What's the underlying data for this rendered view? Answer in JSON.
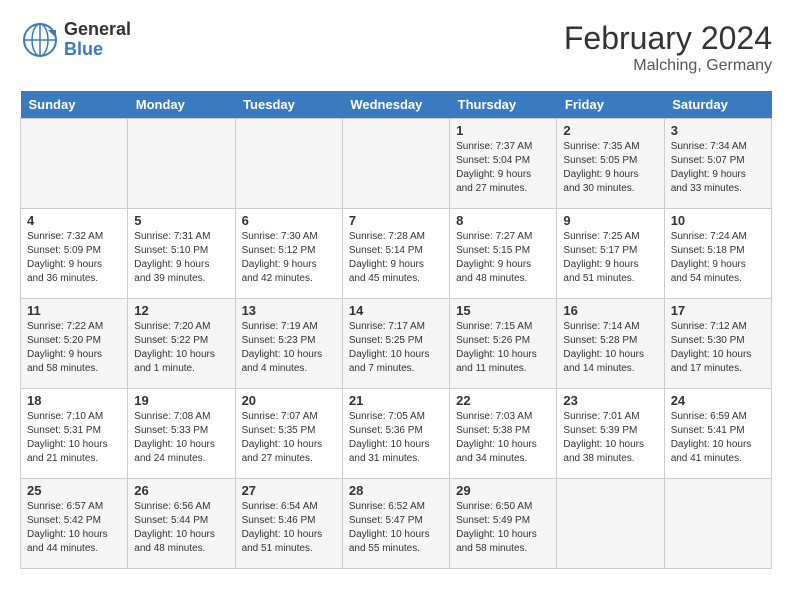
{
  "header": {
    "logo_general": "General",
    "logo_blue": "Blue",
    "month_year": "February 2024",
    "location": "Malching, Germany"
  },
  "days_of_week": [
    "Sunday",
    "Monday",
    "Tuesday",
    "Wednesday",
    "Thursday",
    "Friday",
    "Saturday"
  ],
  "weeks": [
    [
      {
        "num": "",
        "info": ""
      },
      {
        "num": "",
        "info": ""
      },
      {
        "num": "",
        "info": ""
      },
      {
        "num": "",
        "info": ""
      },
      {
        "num": "1",
        "info": "Sunrise: 7:37 AM\nSunset: 5:04 PM\nDaylight: 9 hours\nand 27 minutes."
      },
      {
        "num": "2",
        "info": "Sunrise: 7:35 AM\nSunset: 5:05 PM\nDaylight: 9 hours\nand 30 minutes."
      },
      {
        "num": "3",
        "info": "Sunrise: 7:34 AM\nSunset: 5:07 PM\nDaylight: 9 hours\nand 33 minutes."
      }
    ],
    [
      {
        "num": "4",
        "info": "Sunrise: 7:32 AM\nSunset: 5:09 PM\nDaylight: 9 hours\nand 36 minutes."
      },
      {
        "num": "5",
        "info": "Sunrise: 7:31 AM\nSunset: 5:10 PM\nDaylight: 9 hours\nand 39 minutes."
      },
      {
        "num": "6",
        "info": "Sunrise: 7:30 AM\nSunset: 5:12 PM\nDaylight: 9 hours\nand 42 minutes."
      },
      {
        "num": "7",
        "info": "Sunrise: 7:28 AM\nSunset: 5:14 PM\nDaylight: 9 hours\nand 45 minutes."
      },
      {
        "num": "8",
        "info": "Sunrise: 7:27 AM\nSunset: 5:15 PM\nDaylight: 9 hours\nand 48 minutes."
      },
      {
        "num": "9",
        "info": "Sunrise: 7:25 AM\nSunset: 5:17 PM\nDaylight: 9 hours\nand 51 minutes."
      },
      {
        "num": "10",
        "info": "Sunrise: 7:24 AM\nSunset: 5:18 PM\nDaylight: 9 hours\nand 54 minutes."
      }
    ],
    [
      {
        "num": "11",
        "info": "Sunrise: 7:22 AM\nSunset: 5:20 PM\nDaylight: 9 hours\nand 58 minutes."
      },
      {
        "num": "12",
        "info": "Sunrise: 7:20 AM\nSunset: 5:22 PM\nDaylight: 10 hours\nand 1 minute."
      },
      {
        "num": "13",
        "info": "Sunrise: 7:19 AM\nSunset: 5:23 PM\nDaylight: 10 hours\nand 4 minutes."
      },
      {
        "num": "14",
        "info": "Sunrise: 7:17 AM\nSunset: 5:25 PM\nDaylight: 10 hours\nand 7 minutes."
      },
      {
        "num": "15",
        "info": "Sunrise: 7:15 AM\nSunset: 5:26 PM\nDaylight: 10 hours\nand 11 minutes."
      },
      {
        "num": "16",
        "info": "Sunrise: 7:14 AM\nSunset: 5:28 PM\nDaylight: 10 hours\nand 14 minutes."
      },
      {
        "num": "17",
        "info": "Sunrise: 7:12 AM\nSunset: 5:30 PM\nDaylight: 10 hours\nand 17 minutes."
      }
    ],
    [
      {
        "num": "18",
        "info": "Sunrise: 7:10 AM\nSunset: 5:31 PM\nDaylight: 10 hours\nand 21 minutes."
      },
      {
        "num": "19",
        "info": "Sunrise: 7:08 AM\nSunset: 5:33 PM\nDaylight: 10 hours\nand 24 minutes."
      },
      {
        "num": "20",
        "info": "Sunrise: 7:07 AM\nSunset: 5:35 PM\nDaylight: 10 hours\nand 27 minutes."
      },
      {
        "num": "21",
        "info": "Sunrise: 7:05 AM\nSunset: 5:36 PM\nDaylight: 10 hours\nand 31 minutes."
      },
      {
        "num": "22",
        "info": "Sunrise: 7:03 AM\nSunset: 5:38 PM\nDaylight: 10 hours\nand 34 minutes."
      },
      {
        "num": "23",
        "info": "Sunrise: 7:01 AM\nSunset: 5:39 PM\nDaylight: 10 hours\nand 38 minutes."
      },
      {
        "num": "24",
        "info": "Sunrise: 6:59 AM\nSunset: 5:41 PM\nDaylight: 10 hours\nand 41 minutes."
      }
    ],
    [
      {
        "num": "25",
        "info": "Sunrise: 6:57 AM\nSunset: 5:42 PM\nDaylight: 10 hours\nand 44 minutes."
      },
      {
        "num": "26",
        "info": "Sunrise: 6:56 AM\nSunset: 5:44 PM\nDaylight: 10 hours\nand 48 minutes."
      },
      {
        "num": "27",
        "info": "Sunrise: 6:54 AM\nSunset: 5:46 PM\nDaylight: 10 hours\nand 51 minutes."
      },
      {
        "num": "28",
        "info": "Sunrise: 6:52 AM\nSunset: 5:47 PM\nDaylight: 10 hours\nand 55 minutes."
      },
      {
        "num": "29",
        "info": "Sunrise: 6:50 AM\nSunset: 5:49 PM\nDaylight: 10 hours\nand 58 minutes."
      },
      {
        "num": "",
        "info": ""
      },
      {
        "num": "",
        "info": ""
      }
    ]
  ]
}
